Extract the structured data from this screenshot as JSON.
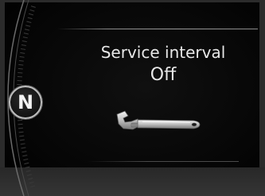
{
  "display": {
    "gear": "N",
    "message": {
      "title": "Service interval",
      "value": "Off"
    },
    "icon": "wrench-icon"
  },
  "colors": {
    "background": "#000000",
    "text": "#e8e8e8",
    "bezel": "#2b2b2b",
    "accent": "#bdbdbd"
  }
}
